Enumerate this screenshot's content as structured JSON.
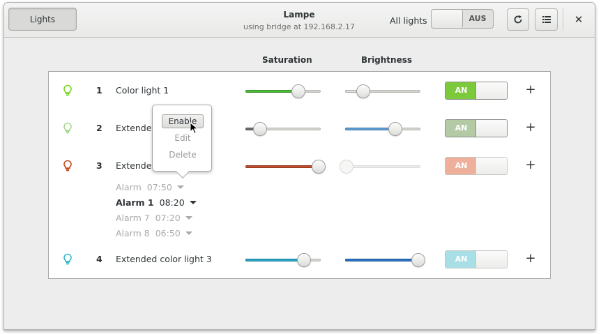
{
  "header": {
    "lights_button": "Lights",
    "title": "Lampe",
    "subtitle": "using bridge at 192.168.2.17",
    "all_lights_label": "All lights",
    "all_lights_switch": "AUS",
    "refresh_icon": "refresh-icon",
    "menu_icon": "list-icon",
    "close_icon": "close-icon",
    "close_glyph": "✕"
  },
  "columns": {
    "saturation": "Saturation",
    "brightness": "Brightness"
  },
  "lights": [
    {
      "num": "1",
      "name": "Color light 1",
      "bulb_color": "#73d216",
      "saturation": 0.7,
      "saturation_color": "#4fc13a",
      "brightness": 0.24,
      "brightness_color": "#e4e4e2",
      "brightness_disabled": false,
      "on_label": "AN",
      "on_color": "#7dc93c",
      "faded": false
    },
    {
      "num": "2",
      "name": "Extended",
      "bulb_color": "#a3d68a",
      "saturation": 0.19,
      "saturation_color": "#6e6e6e",
      "brightness": 0.67,
      "brightness_color": "#5f9ed8",
      "brightness_disabled": false,
      "on_label": "AN",
      "on_color": "#b4caa5",
      "faded": false
    },
    {
      "num": "3",
      "name": "Extended",
      "bulb_color": "#c4431a",
      "saturation": 0.97,
      "saturation_color": "#c44d2c",
      "brightness": 0.02,
      "brightness_color": "#ededeb",
      "brightness_disabled": true,
      "on_label": "AN",
      "on_color": "#eeaf9b",
      "faded": true
    },
    {
      "num": "4",
      "name": "Extended color light 3",
      "bulb_color": "#2fb6c8",
      "saturation": 0.78,
      "saturation_color": "#26a6c7",
      "brightness": 0.97,
      "brightness_color": "#2b72c6",
      "brightness_disabled": false,
      "on_label": "AN",
      "on_color": "#a8dfe6",
      "faded": true
    }
  ],
  "alarms": [
    {
      "label": "Alarm",
      "time": "07:50",
      "active": false
    },
    {
      "label": "Alarm 1",
      "time": "08:20",
      "active": true
    },
    {
      "label": "Alarm 7",
      "time": "07:20",
      "active": false
    },
    {
      "label": "Alarm 8",
      "time": "06:50",
      "active": false
    }
  ],
  "popover": {
    "items": [
      "Enable",
      "Edit",
      "Delete"
    ],
    "hovered": "Enable"
  }
}
